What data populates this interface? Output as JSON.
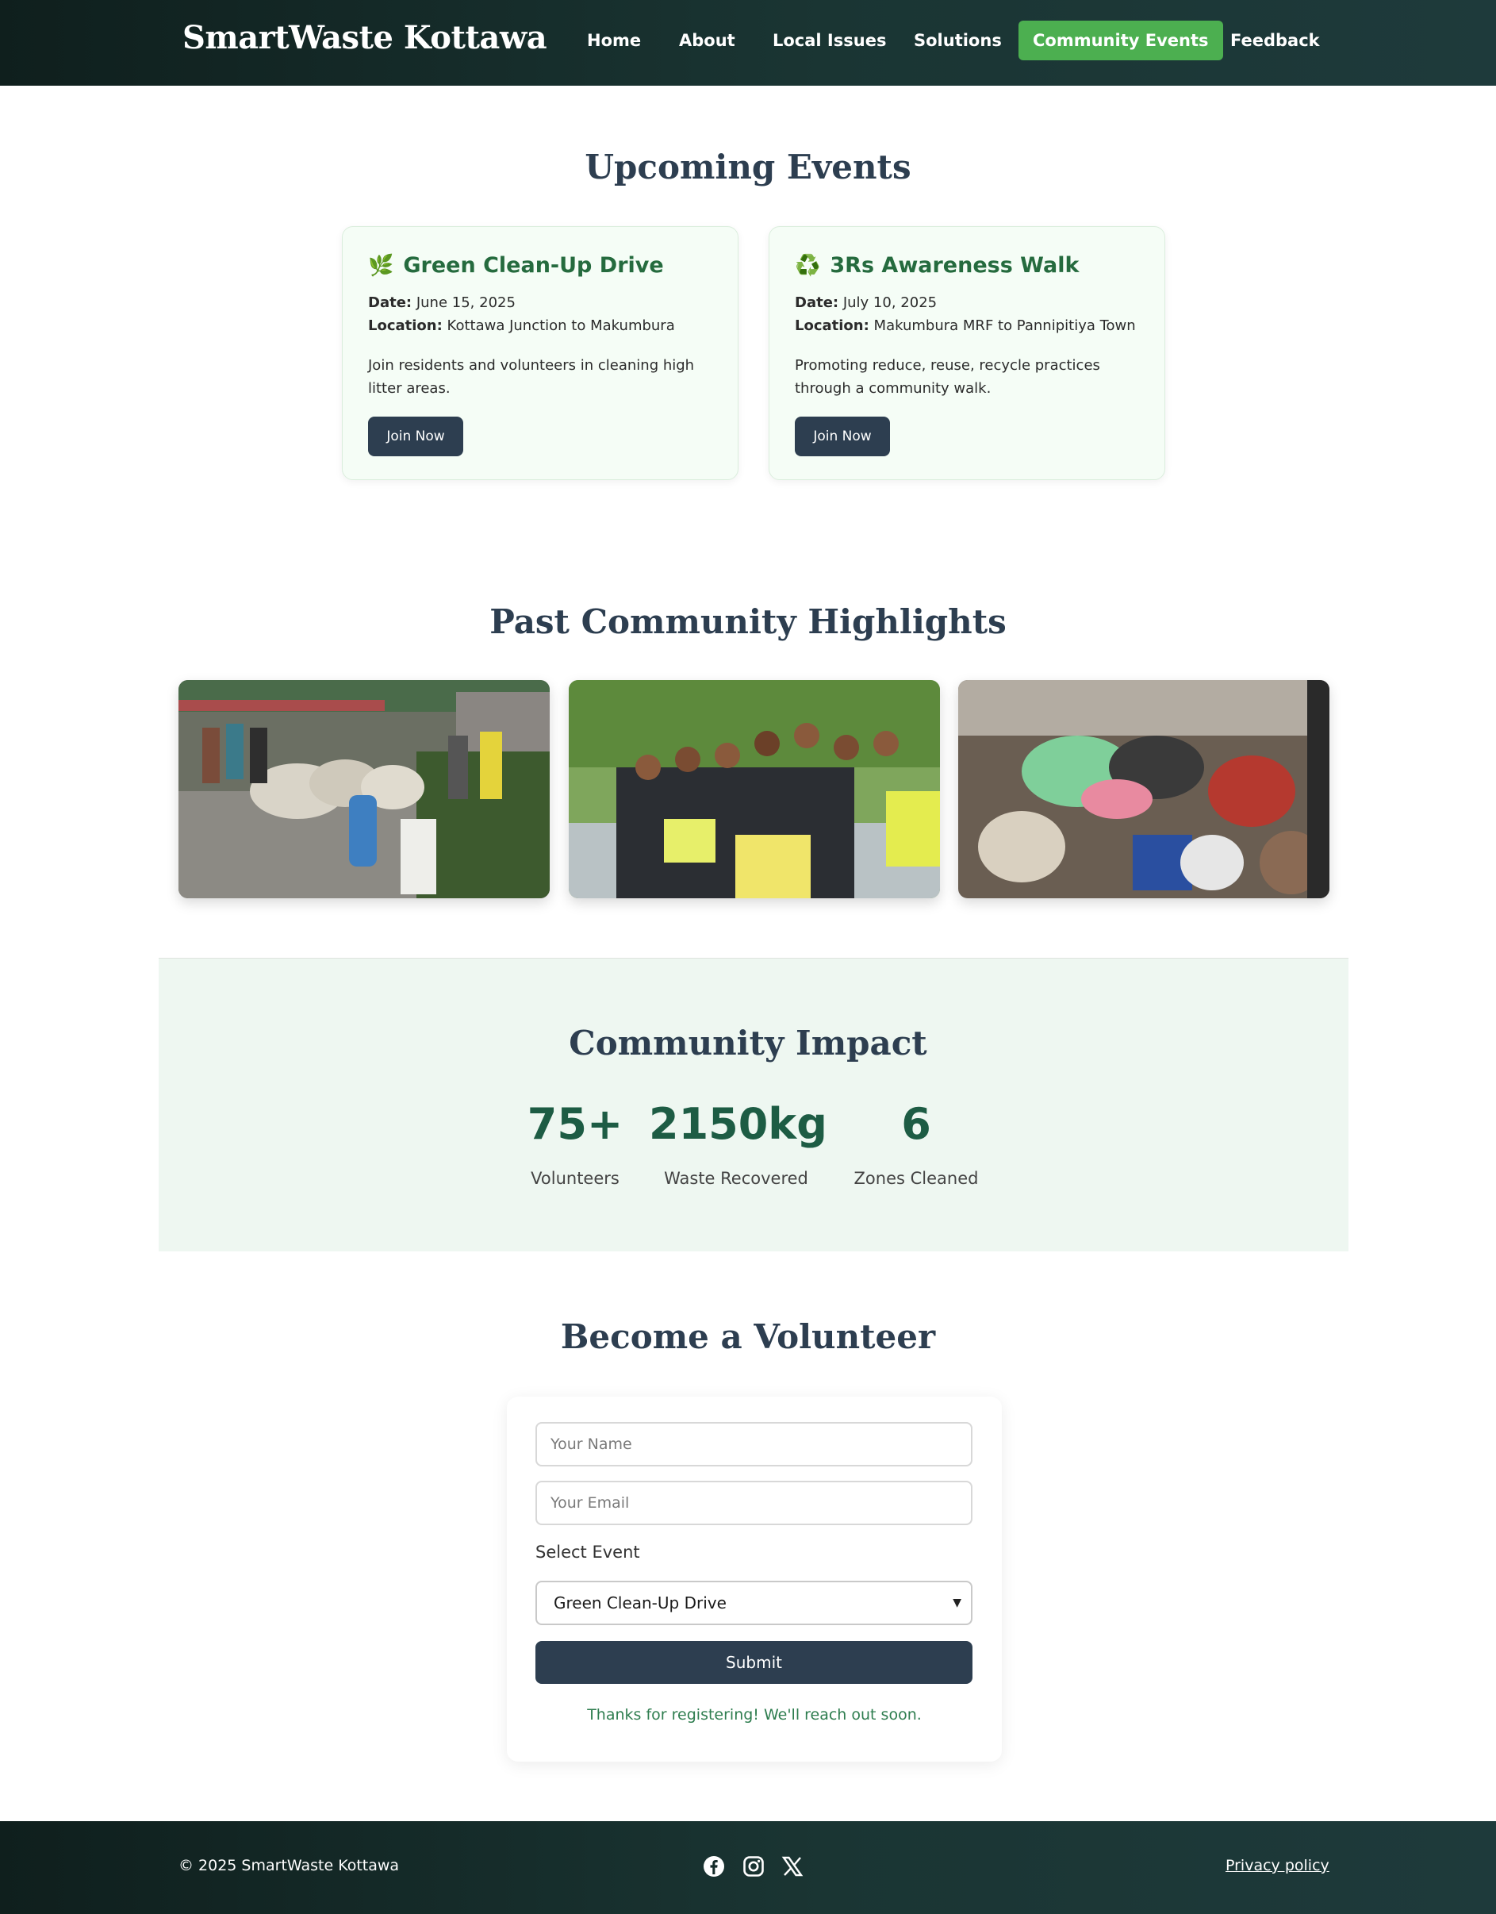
{
  "header": {
    "brand": "SmartWaste Kottawa",
    "nav": [
      {
        "label": "Home"
      },
      {
        "label": "About"
      },
      {
        "label": "Local Issues"
      },
      {
        "label": "Solutions"
      },
      {
        "label": "Community Events",
        "active": true
      },
      {
        "label": "Feedback"
      }
    ]
  },
  "upcoming": {
    "title": "Upcoming Events",
    "events": [
      {
        "icon": "🌿",
        "icon_name": "leaf-icon",
        "title": "Green Clean-Up Drive",
        "date_label": "Date:",
        "date": "June 15, 2025",
        "location_label": "Location:",
        "location": "Kottawa Junction to Makumbura",
        "description": "Join residents and volunteers in cleaning high litter areas.",
        "button": "Join Now"
      },
      {
        "icon": "♻️",
        "icon_name": "recycle-icon",
        "title": "3Rs Awareness Walk",
        "date_label": "Date:",
        "date": "July 10, 2025",
        "location_label": "Location:",
        "location": "Makumbura MRF to Pannipitiya Town",
        "description": "Promoting reduce, reuse, recycle practices through a community walk.",
        "button": "Join Now"
      }
    ]
  },
  "highlights": {
    "title": "Past Community Highlights"
  },
  "impact": {
    "title": "Community Impact",
    "stats": [
      {
        "value": "75+",
        "label": "Volunteers"
      },
      {
        "value": "2150kg",
        "label": "Waste Recovered"
      },
      {
        "value": "6",
        "label": "Zones Cleaned"
      }
    ]
  },
  "volunteer": {
    "title": "Become a Volunteer",
    "name_placeholder": "Your Name",
    "email_placeholder": "Your Email",
    "select_label": "Select Event",
    "select_value": "Green Clean-Up Drive",
    "submit": "Submit",
    "confirmation": "Thanks for registering! We'll reach out soon."
  },
  "footer": {
    "copyright": "© 2025 SmartWaste Kottawa",
    "social": [
      "facebook-icon",
      "instagram-icon",
      "x-icon"
    ],
    "privacy": "Privacy policy"
  },
  "colors": {
    "nav_bg": "#132726",
    "active_nav": "#4caf50",
    "heading": "#2d3e50",
    "card_title": "#256b3e",
    "stat": "#1d5c44",
    "button": "#2d3e50",
    "impact_bg": "#eef7f1"
  }
}
